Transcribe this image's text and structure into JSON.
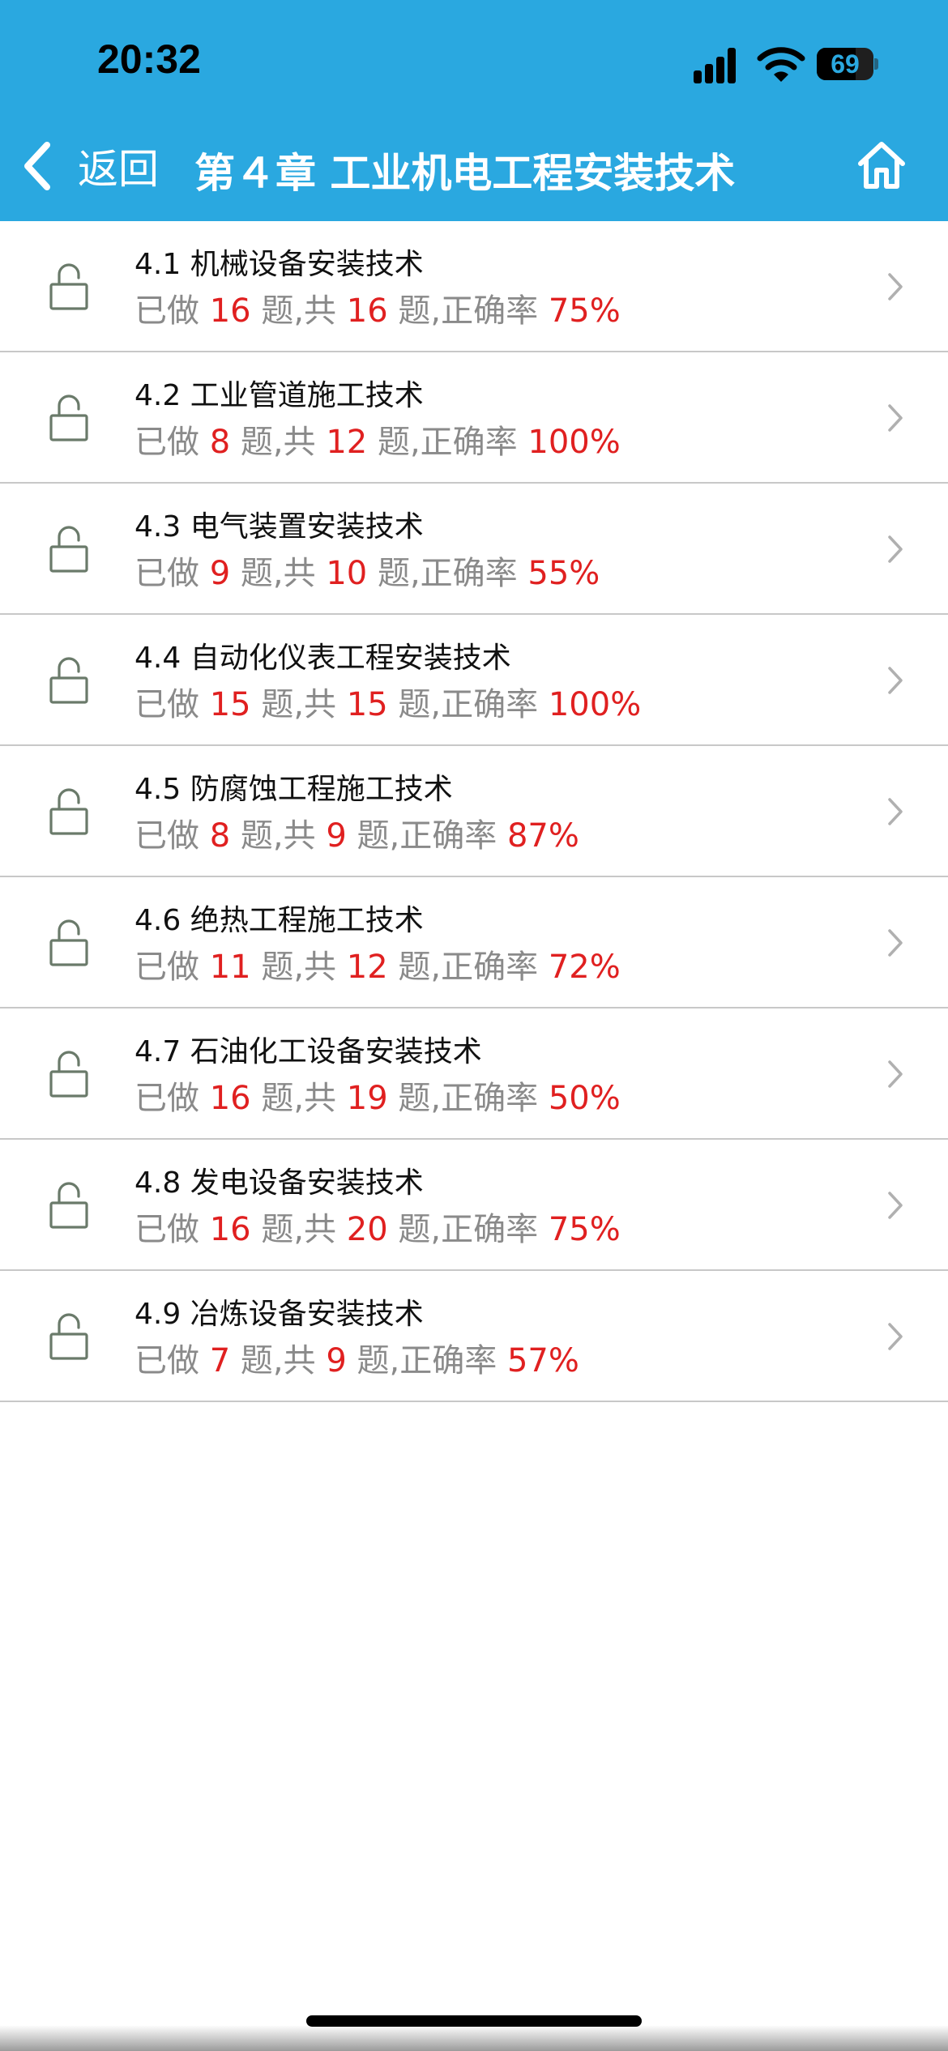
{
  "status_bar": {
    "time": "20:32",
    "battery": "69",
    "battery_level": 0.69
  },
  "nav": {
    "back_label": "返回",
    "title": "第４章 工业机电工程安装技术"
  },
  "colors": {
    "header_bg": "#2aa8e0",
    "highlight_number": "#e02020",
    "stats_text": "#8a8a8a"
  },
  "labels": {
    "done_prefix": "已做",
    "unit": "题",
    "total_prefix": ",共",
    "accuracy_prefix": ",正确率"
  },
  "sections": [
    {
      "title": "4.1 机械设备安装技术",
      "done": "16",
      "total": "16",
      "accuracy": "75%"
    },
    {
      "title": "4.2 工业管道施工技术",
      "done": "8",
      "total": "12",
      "accuracy": "100%"
    },
    {
      "title": "4.3 电气装置安装技术",
      "done": "9",
      "total": "10",
      "accuracy": "55%"
    },
    {
      "title": "4.4 自动化仪表工程安装技术",
      "done": "15",
      "total": "15",
      "accuracy": "100%"
    },
    {
      "title": "4.5 防腐蚀工程施工技术",
      "done": "8",
      "total": "9",
      "accuracy": "87%"
    },
    {
      "title": "4.6 绝热工程施工技术",
      "done": "11",
      "total": "12",
      "accuracy": "72%"
    },
    {
      "title": "4.7 石油化工设备安装技术",
      "done": "16",
      "total": "19",
      "accuracy": "50%"
    },
    {
      "title": "4.8 发电设备安装技术",
      "done": "16",
      "total": "20",
      "accuracy": "75%"
    },
    {
      "title": "4.9 冶炼设备安装技术",
      "done": "7",
      "total": "9",
      "accuracy": "57%"
    }
  ],
  "icons": {
    "lock": "unlocked-padlock-icon",
    "row_arrow": "chevron-right-icon",
    "back": "chevron-left-icon",
    "home": "home-icon"
  }
}
